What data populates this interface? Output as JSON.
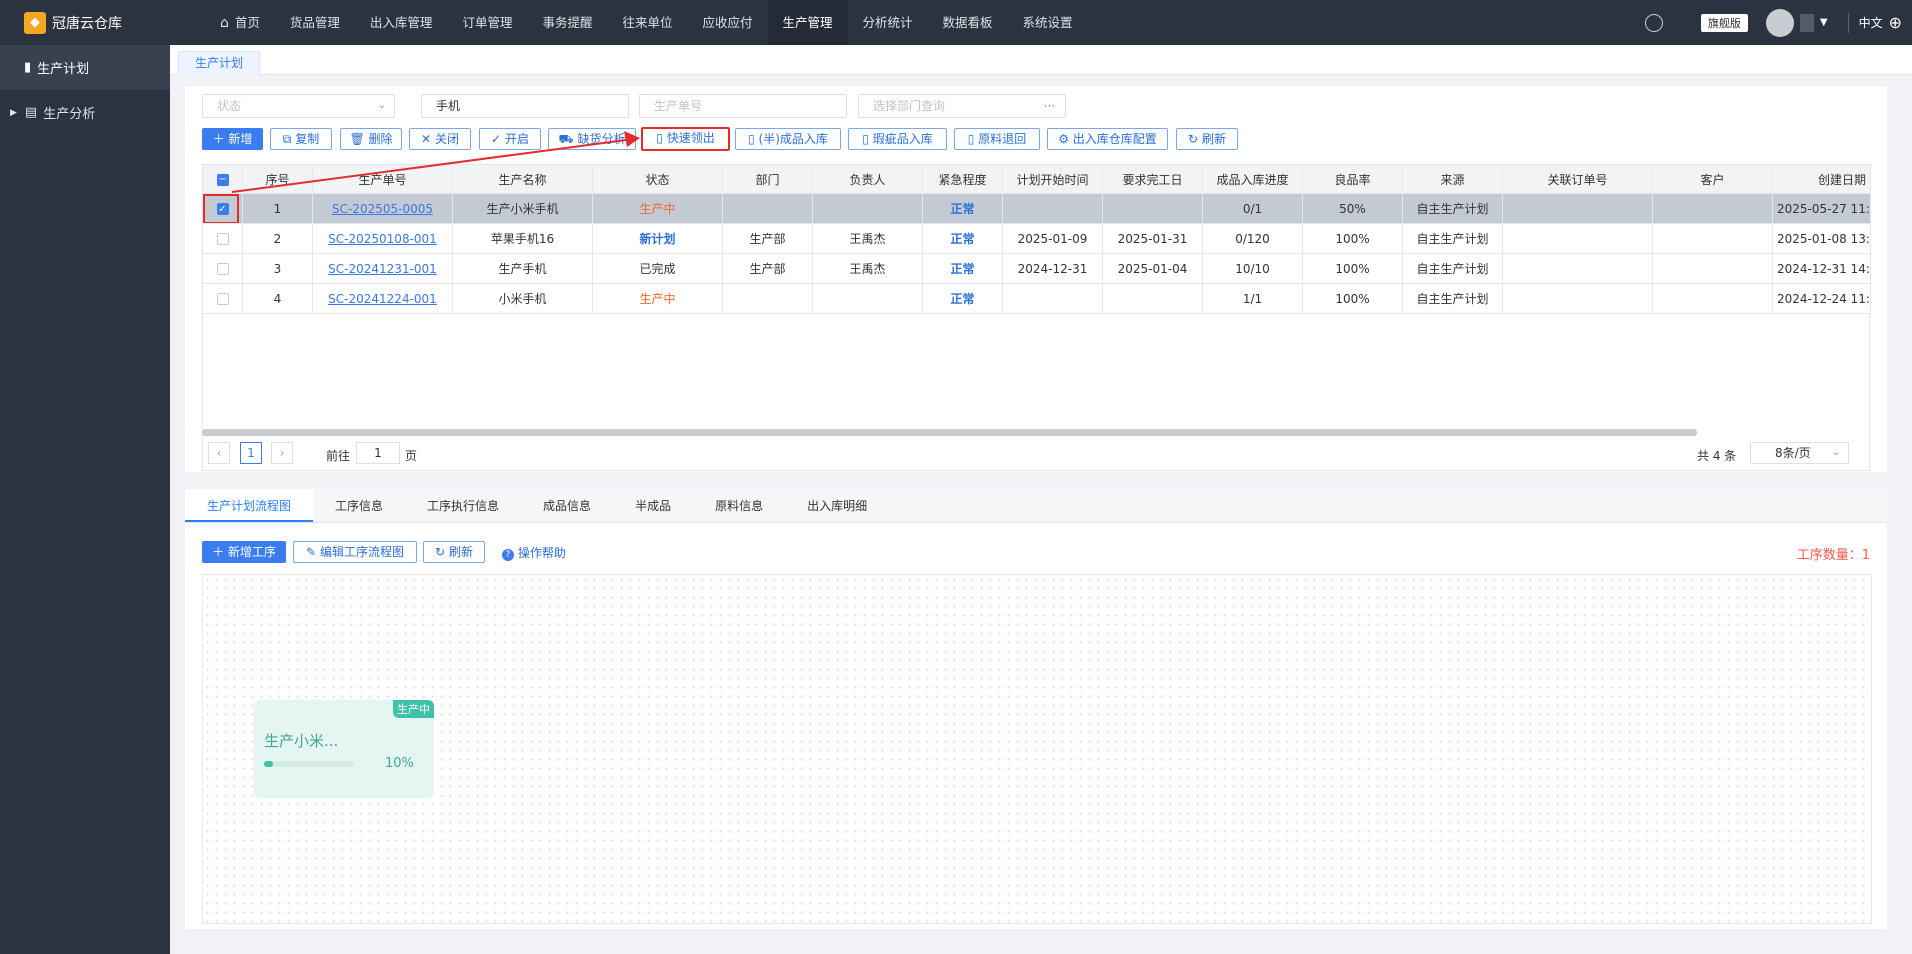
{
  "app": {
    "name": "冠唐云仓库"
  },
  "nav": [
    "首页",
    "货品管理",
    "出入库管理",
    "订单管理",
    "事务提醒",
    "往来单位",
    "应收应付",
    "生产管理",
    "分析统计",
    "数据看板",
    "系统设置"
  ],
  "topright": {
    "edition": "旗舰版",
    "lang": "中文"
  },
  "sidebar": {
    "items": [
      "生产计划",
      "生产分析"
    ]
  },
  "page_tab": "生产计划",
  "filters": {
    "status": "状态",
    "keyword": "手机",
    "order_no": "生产单号",
    "dept": "选择部门查询",
    "more": "···"
  },
  "toolbar": {
    "add": "新增",
    "copy": "复制",
    "delete": "删除",
    "close": "关闭",
    "open": "开启",
    "shortage": "缺货分析",
    "quick_pick": "快速领出",
    "finished_in": "(半)成品入库",
    "defect_in": "瑕疵品入库",
    "material_return": "原料退回",
    "wh_config": "出入库仓库配置",
    "refresh": "刷新"
  },
  "table": {
    "headers": [
      "序号",
      "生产单号",
      "生产名称",
      "状态",
      "部门",
      "负责人",
      "紧急程度",
      "计划开始时间",
      "要求完工日",
      "成品入库进度",
      "良品率",
      "来源",
      "关联订单号",
      "客户",
      "创建日期"
    ],
    "rows": [
      {
        "no": "1",
        "order": "SC-202505-0005",
        "name": "生产小米手机",
        "status": "生产中",
        "dept": "",
        "owner": "",
        "urgency": "正常",
        "start": "",
        "due": "",
        "progress": "0/1",
        "yield": "50%",
        "source": "自主生产计划",
        "related": "",
        "customer": "",
        "created": "2025-05-27 11:"
      },
      {
        "no": "2",
        "order": "SC-20250108-001",
        "name": "苹果手机16",
        "status": "新计划",
        "dept": "生产部",
        "owner": "王禹杰",
        "urgency": "正常",
        "start": "2025-01-09",
        "due": "2025-01-31",
        "progress": "0/120",
        "yield": "100%",
        "source": "自主生产计划",
        "related": "",
        "customer": "",
        "created": "2025-01-08 13:"
      },
      {
        "no": "3",
        "order": "SC-20241231-001",
        "name": "生产手机",
        "status": "已完成",
        "dept": "生产部",
        "owner": "王禹杰",
        "urgency": "正常",
        "start": "2024-12-31",
        "due": "2025-01-04",
        "progress": "10/10",
        "yield": "100%",
        "source": "自主生产计划",
        "related": "",
        "customer": "",
        "created": "2024-12-31 14:"
      },
      {
        "no": "4",
        "order": "SC-20241224-001",
        "name": "小米手机",
        "status": "生产中",
        "dept": "",
        "owner": "",
        "urgency": "正常",
        "start": "",
        "due": "",
        "progress": "1/1",
        "yield": "100%",
        "source": "自主生产计划",
        "related": "",
        "customer": "",
        "created": "2024-12-24 11:"
      }
    ]
  },
  "pager": {
    "page": "1",
    "goto_label": "前往",
    "goto_value": "1",
    "page_unit": "页",
    "total": "共 4 条",
    "page_size": "8条/页"
  },
  "detail_tabs": [
    "生产计划流程图",
    "工序信息",
    "工序执行信息",
    "成品信息",
    "半成品",
    "原料信息",
    "出入库明细"
  ],
  "flow_toolbar": {
    "add": "新增工序",
    "edit": "编辑工序流程图",
    "refresh": "刷新",
    "help": "操作帮助",
    "count": "工序数量：1"
  },
  "node": {
    "title": "生产小米...",
    "badge": "生产中",
    "percent": "10%",
    "progress": 0.1
  }
}
